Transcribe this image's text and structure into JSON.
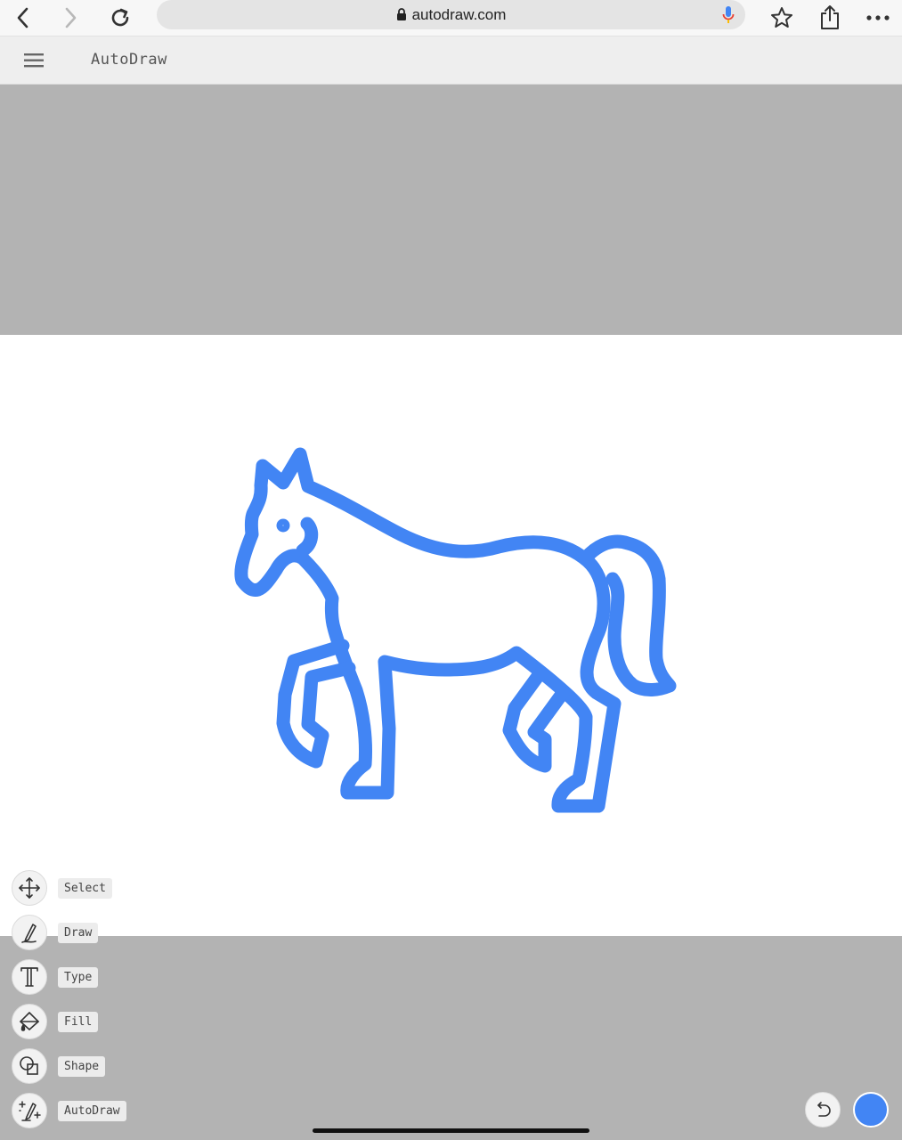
{
  "browser": {
    "url": "autodraw.com",
    "icons": [
      "back-icon",
      "forward-icon",
      "reload-icon",
      "lock-icon",
      "microphone-icon",
      "star-icon",
      "share-icon",
      "more-icon"
    ]
  },
  "app": {
    "title": "AutoDraw",
    "menu_icon": "hamburger-menu-icon"
  },
  "canvas": {
    "drawing": "horse-outline",
    "stroke_color": "#4285f4"
  },
  "tools": [
    {
      "label": "Select",
      "icon": "move-icon"
    },
    {
      "label": "Draw",
      "icon": "pencil-icon"
    },
    {
      "label": "Type",
      "icon": "text-icon"
    },
    {
      "label": "Fill",
      "icon": "paint-bucket-icon"
    },
    {
      "label": "Shape",
      "icon": "shapes-icon"
    },
    {
      "label": "AutoDraw",
      "icon": "autodraw-sparkle-icon"
    }
  ],
  "controls": {
    "undo_icon": "undo-icon",
    "current_color": "#4285f4"
  },
  "colors": {
    "accent": "#4285f4",
    "backdrop": "#b3b3b3"
  }
}
